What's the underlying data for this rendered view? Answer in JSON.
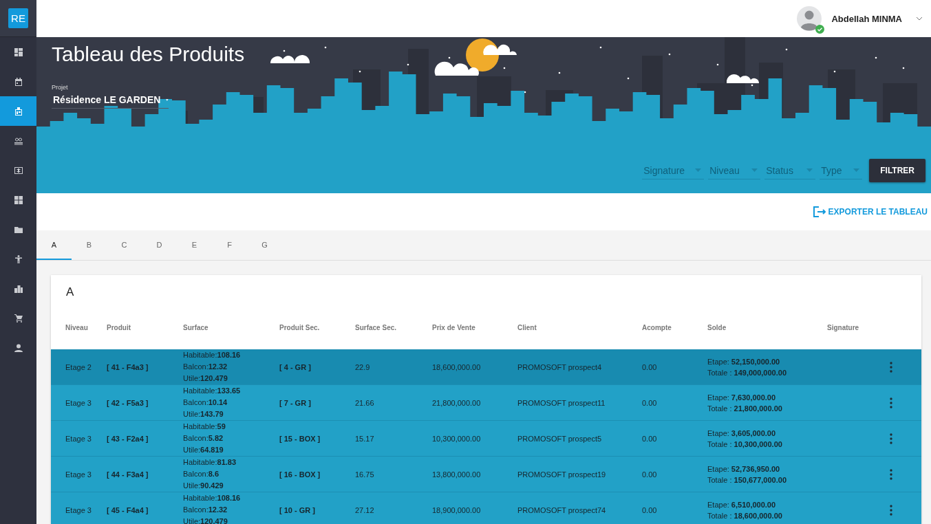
{
  "logo": "RE",
  "sidebar": {
    "items": [
      {
        "selected": false
      },
      {
        "selected": false
      },
      {
        "selected": true
      },
      {
        "selected": false
      },
      {
        "selected": false
      },
      {
        "selected": false
      },
      {
        "selected": false
      },
      {
        "selected": false
      },
      {
        "selected": false
      },
      {
        "selected": false
      },
      {
        "selected": false
      }
    ]
  },
  "user": {
    "name": "Abdellah MINMA",
    "online": true
  },
  "page_title": "Tableau des Produits",
  "project": {
    "label": "Projet",
    "value": "Résidence LE GARDEN"
  },
  "filters": [
    {
      "placeholder": "Signature"
    },
    {
      "placeholder": "Niveau"
    },
    {
      "placeholder": "Status"
    },
    {
      "placeholder": "Type"
    }
  ],
  "filter_button": "FILTRER",
  "export_link": "EXPORTER LE TABLEAU",
  "tabs": [
    {
      "label": "A",
      "selected": true
    },
    {
      "label": "B",
      "selected": false
    },
    {
      "label": "C",
      "selected": false
    },
    {
      "label": "D",
      "selected": false
    },
    {
      "label": "E",
      "selected": false
    },
    {
      "label": "F",
      "selected": false
    },
    {
      "label": "G",
      "selected": false
    }
  ],
  "table": {
    "title": "A",
    "columns": [
      "Niveau",
      "Produit",
      "Surface",
      "Produit Sec.",
      "Surface Sec.",
      "Prix de Vente",
      "Client",
      "Acompte",
      "Solde",
      "Signature"
    ],
    "rows": [
      {
        "selected": true,
        "niveau": "Etage 2",
        "produit": "[ 41 - F4a3 ]",
        "surface": [
          "Habitable:**108.16**",
          "Balcon:**12.32**",
          "Utile:**120.479**"
        ],
        "produit_sec": "[ 4 - GR ]",
        "surface_sec": "22.9",
        "prix": "18,600,000.00",
        "client": "PROMOSOFT prospect4",
        "acompte": "0.00",
        "solde": [
          "Etape: **52,150,000.00**",
          "Totale : **149,000,000.00**"
        ]
      },
      {
        "selected": false,
        "niveau": "Etage 3",
        "produit": "[ 42 - F5a3 ]",
        "surface": [
          "Habitable:**133.65**",
          "Balcon:**10.14**",
          "Utile:**143.79**"
        ],
        "produit_sec": "[ 7 - GR ]",
        "surface_sec": "21.66",
        "prix": "21,800,000.00",
        "client": "PROMOSOFT prospect11",
        "acompte": "0.00",
        "solde": [
          "Etape: **7,630,000.00**",
          "Totale : **21,800,000.00**"
        ]
      },
      {
        "selected": false,
        "niveau": "Etage 3",
        "produit": "[ 43 - F2a4 ]",
        "surface": [
          "Habitable:**59**",
          "Balcon:**5.82**",
          "Utile:**64.819**"
        ],
        "produit_sec": "[ 15 - BOX ]",
        "surface_sec": "15.17",
        "prix": "10,300,000.00",
        "client": "PROMOSOFT prospect5",
        "acompte": "0.00",
        "solde": [
          "Etape: **3,605,000.00**",
          "Totale : **10,300,000.00**"
        ]
      },
      {
        "selected": false,
        "niveau": "Etage 3",
        "produit": "[ 44 - F3a4 ]",
        "surface": [
          "Habitable:**81.83**",
          "Balcon:**8.6**",
          "Utile:**90.429**"
        ],
        "produit_sec": "[ 16 - BOX ]",
        "surface_sec": "16.75",
        "prix": "13,800,000.00",
        "client": "PROMOSOFT prospect19",
        "acompte": "0.00",
        "solde": [
          "Etape: **52,736,950.00**",
          "Totale : **150,677,000.00**"
        ]
      },
      {
        "selected": false,
        "niveau": "Etage 3",
        "produit": "[ 45 - F4a4 ]",
        "surface": [
          "Habitable:**108.16**",
          "Balcon:**12.32**",
          "Utile:**120.479**"
        ],
        "produit_sec": "[ 10 - GR ]",
        "surface_sec": "27.12",
        "prix": "18,900,000.00",
        "client": "PROMOSOFT prospect74",
        "acompte": "0.00",
        "solde": [
          "Etape: **6,510,000.00**",
          "Totale : **18,600,000.00**"
        ]
      }
    ]
  }
}
